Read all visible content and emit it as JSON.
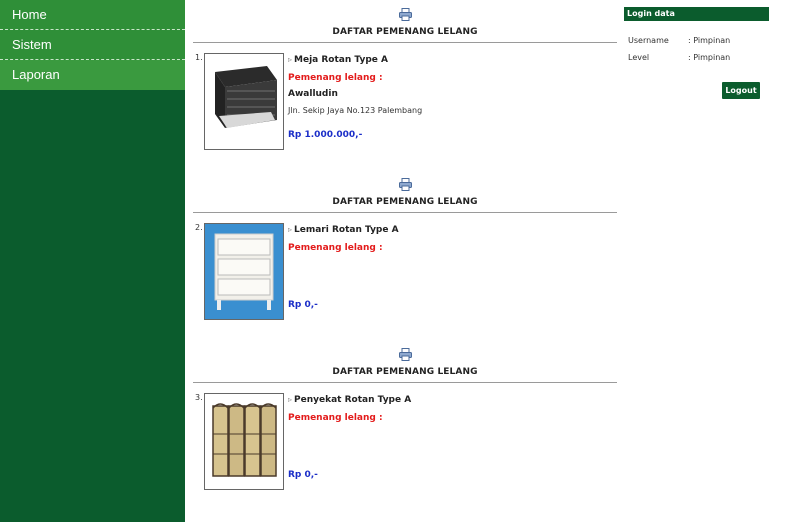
{
  "sidebar": {
    "items": [
      {
        "label": "Home"
      },
      {
        "label": "Sistem"
      },
      {
        "label": "Laporan"
      }
    ]
  },
  "sections": [
    {
      "title": "DAFTAR PEMENANG LELANG",
      "number": "1.",
      "item_name": "Meja Rotan Type A",
      "winner_label": "Pemenang lelang :",
      "winner_name": "Awalludin",
      "winner_address": "Jln. Sekip Jaya No.123 Palembang",
      "price": "Rp 1.000.000,-"
    },
    {
      "title": "DAFTAR PEMENANG LELANG",
      "number": "2.",
      "item_name": "Lemari Rotan Type A",
      "winner_label": "Pemenang lelang :",
      "price": "Rp 0,-"
    },
    {
      "title": "DAFTAR PEMENANG LELANG",
      "number": "3.",
      "item_name": "Penyekat Rotan Type A",
      "winner_label": "Pemenang lelang :",
      "price": "Rp 0,-"
    }
  ],
  "login": {
    "title": "Login data",
    "username_label": "Username",
    "username_value": ": Pimpinan",
    "level_label": "Level",
    "level_value": ": Pimpinan",
    "logout_label": "Logout"
  },
  "colors": {
    "sidebar_dark": "#0b5c2d",
    "nav_green": "#2f8f38",
    "winner_red": "#e31b1b",
    "price_blue": "#1b2ec8"
  }
}
